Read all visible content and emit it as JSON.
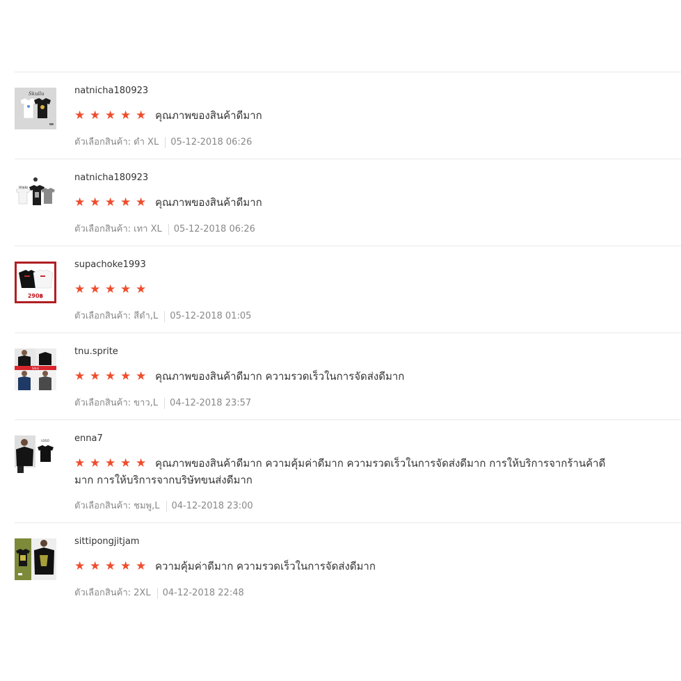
{
  "reviews": [
    {
      "username": "natnicha180923",
      "stars": 5,
      "text": "คุณภาพของสินค้าดีมาก",
      "variation": "ตัวเลือกสินค้า: ดำ XL",
      "datetime": "05-12-2018 06:26",
      "thumbnail_icon": "two-tshirts-white-black"
    },
    {
      "username": "natnicha180923",
      "stars": 5,
      "text": "คุณภาพของสินค้าดีมาก",
      "variation": "ตัวเลือกสินค้า: เทา XL",
      "datetime": "05-12-2018 06:26",
      "thumbnail_icon": "three-tshirts-white-black-grey"
    },
    {
      "username": "supachoke1993",
      "stars": 5,
      "text": "",
      "variation": "ตัวเลือกสินค้า: สีดำ,L",
      "datetime": "05-12-2018 01:05",
      "thumbnail_icon": "sweatshirts-red-frame",
      "thumbnail_caption": "290฿"
    },
    {
      "username": "tnu.sprite",
      "stars": 5,
      "text": "คุณภาพของสินค้าดีมาก ความรวดเร็วในการจัดส่งดีมาก",
      "variation": "ตัวเลือกสินค้า: ขาว,L",
      "datetime": "04-12-2018 23:57",
      "thumbnail_icon": "tshirt-models-collage"
    },
    {
      "username": "enna7",
      "stars": 5,
      "text": "คุณภาพของสินค้าดีมาก ความคุ้มค่าดีมาก ความรวดเร็วในการจัดส่งดีมาก การให้บริการจากร้านค้าดีมาก การให้บริการจากบริษัทขนส่งดีมาก",
      "variation": "ตัวเลือกสินค้า: ชมพู,L",
      "datetime": "04-12-2018 23:00",
      "thumbnail_icon": "tshirt-model-black"
    },
    {
      "username": "sittipongjitjam",
      "stars": 5,
      "text": "ความคุ้มค่าดีมาก ความรวดเร็วในการจัดส่งดีมาก",
      "variation": "ตัวเลือกสินค้า: 2XL",
      "datetime": "04-12-2018 22:48",
      "thumbnail_icon": "tshirt-green-print-model"
    }
  ],
  "colors": {
    "star": "#ee4d2d",
    "divider": "#e8e8e8",
    "meta_text": "#888888"
  }
}
